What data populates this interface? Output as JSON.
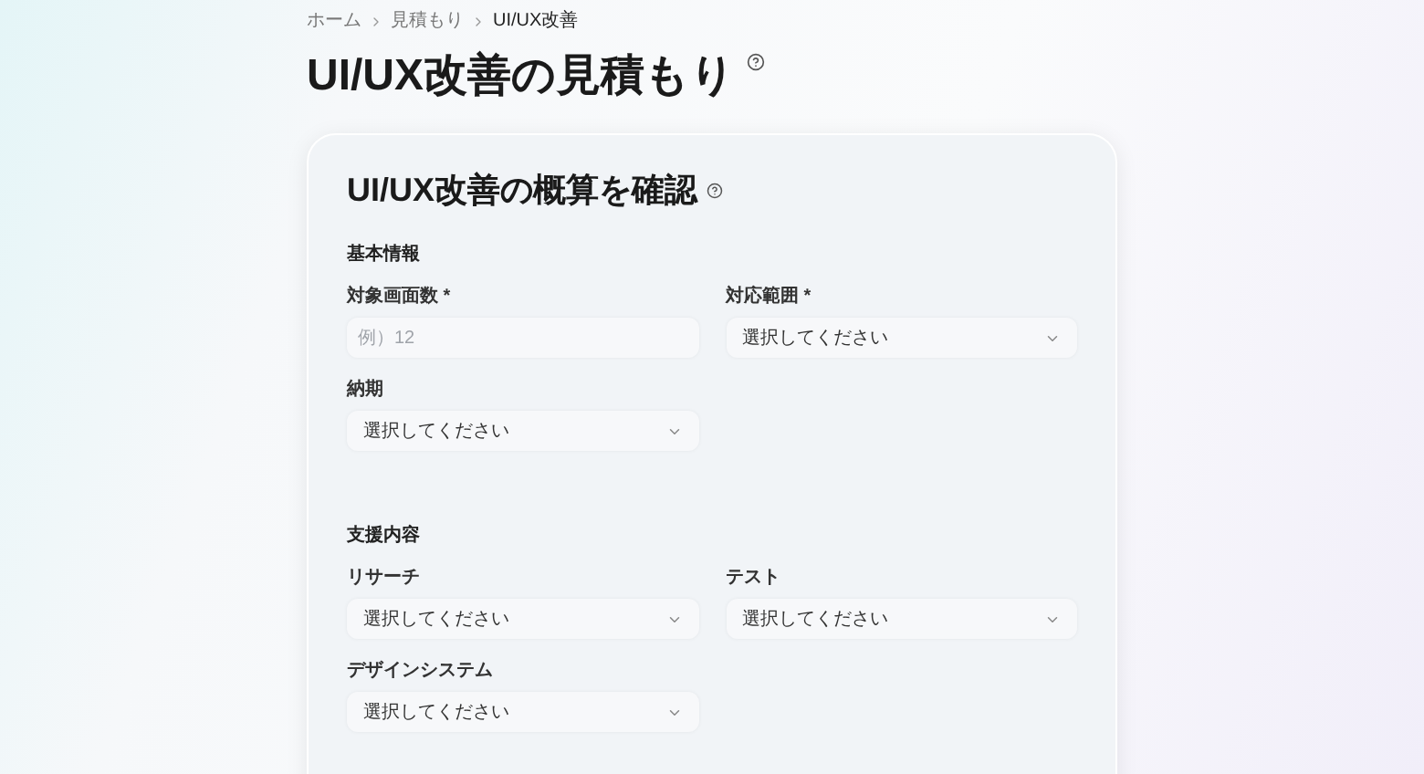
{
  "breadcrumb": [
    "ホーム",
    "見積もり",
    "UI/UX改善"
  ],
  "page_title": "UI/UX改善の見積もり",
  "card": {
    "title": "UI/UX改善の概算を確認",
    "sections": [
      {
        "heading": "基本情報",
        "fields": [
          {
            "kind": "text",
            "label": "対象画面数 *",
            "placeholder": "例）12"
          },
          {
            "kind": "select",
            "label": "対応範囲 *",
            "value": "選択してください"
          },
          {
            "kind": "select",
            "label": "納期",
            "value": "選択してください"
          }
        ]
      },
      {
        "heading": "支援内容",
        "fields": [
          {
            "kind": "select",
            "label": "リサーチ",
            "value": "選択してください"
          },
          {
            "kind": "select",
            "label": "テスト",
            "value": "選択してください"
          },
          {
            "kind": "select",
            "label": "デザインシステム",
            "value": "選択してください"
          }
        ]
      }
    ]
  }
}
